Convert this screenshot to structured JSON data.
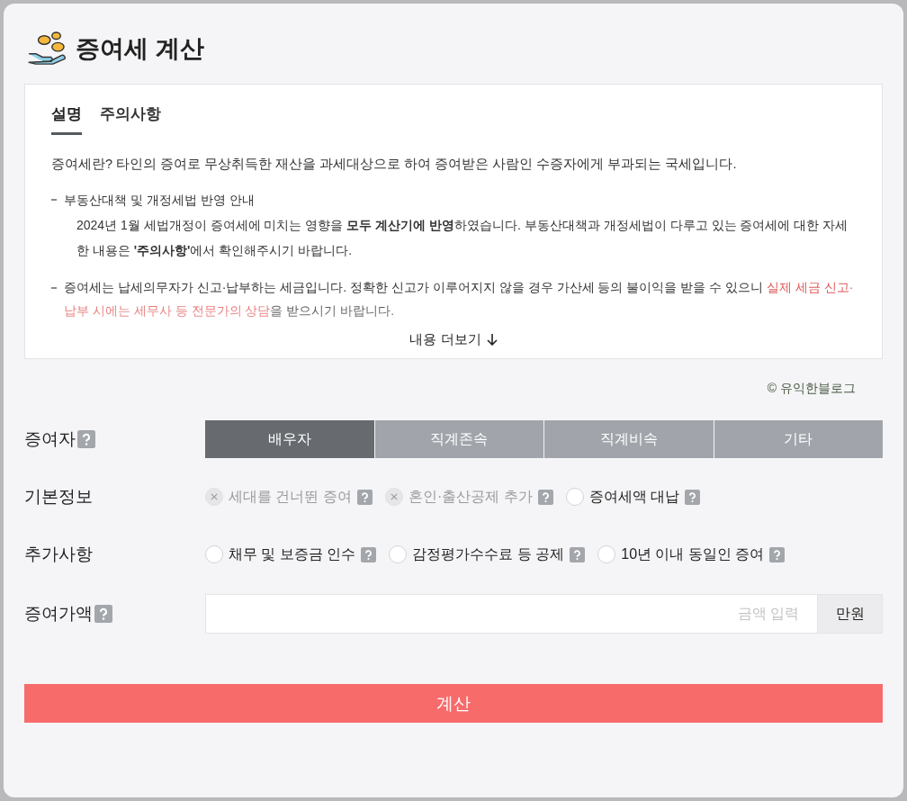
{
  "title": "증여세 계산",
  "tabs": [
    {
      "label": "설명",
      "selected": true
    },
    {
      "label": "주의사항",
      "selected": false
    }
  ],
  "intro": "증여세란? 타인의 증여로 무상취득한 재산을 과세대상으로 하여 증여받은 사람인 수증자에게 부과되는 국세입니다.",
  "notes": [
    {
      "heading": "부동산대책 및 개정세법 반영 안내",
      "body": "2024년 1월 세법개정이 증여세에 미치는 영향을 **모두 계산기에 반영**하였습니다. 부동산대책과 개정세법이 다루고 있는 증여세에 대한 자세한 내용은 **'주의사항'**에서 확인해주시기 바랍니다."
    },
    {
      "segments": [
        {
          "kind": "plain",
          "text": "증여세는 납세의무자가 신고·납부하는 세금입니다. 정확한 신고가 이루어지지 않을 경우 가산세 등의 불이익을 받을 수 있으니 "
        },
        {
          "kind": "warning",
          "text": "실제 세금 신고·납부 시에는 세무사 등 전문가의 상담"
        },
        {
          "kind": "plain",
          "text": "을 받으시기 바랍니다."
        }
      ]
    }
  ],
  "more_button": "내용 더보기",
  "credit": "© 유익한블로그",
  "rows": [
    {
      "kind": "segments",
      "label": "증여자",
      "help": true,
      "options": [
        {
          "label": "배우자",
          "selected": true
        },
        {
          "label": "직계존속",
          "selected": false
        },
        {
          "label": "직계비속",
          "selected": false
        },
        {
          "label": "기타",
          "selected": false
        }
      ]
    },
    {
      "kind": "checks",
      "label": "기본정보",
      "help": false,
      "options": [
        {
          "label": "세대를 건너뛴 증여",
          "disabled": true
        },
        {
          "label": "혼인·출산공제 추가",
          "disabled": true
        },
        {
          "label": "증여세액 대납",
          "disabled": false,
          "checked": false
        }
      ]
    },
    {
      "kind": "checks",
      "label": "추가사항",
      "help": false,
      "options": [
        {
          "label": "채무 및 보증금 인수",
          "disabled": false,
          "checked": false
        },
        {
          "label": "감정평가수수료 등 공제",
          "disabled": false,
          "checked": false
        },
        {
          "label": "10년 이내 동일인 증여",
          "disabled": false,
          "checked": false
        }
      ]
    },
    {
      "kind": "amount",
      "label": "증여가액",
      "help": true,
      "placeholder": "금액 입력",
      "unit": "만원"
    }
  ],
  "submit": "계산"
}
